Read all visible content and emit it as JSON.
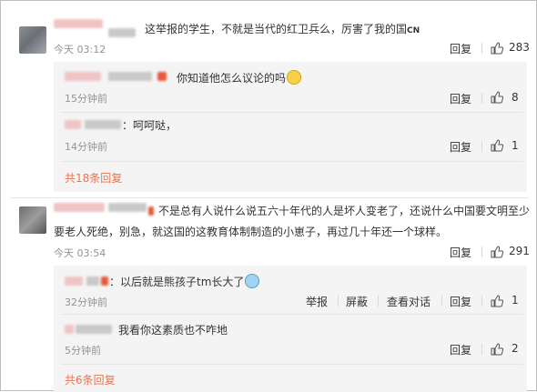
{
  "comments": [
    {
      "text": "这举报的学生，不就是当代的红卫兵么，厉害了我的国",
      "tag": "CN",
      "time": "今天 03:12",
      "reply_label": "回复",
      "likes": "283",
      "replies": [
        {
          "text": "你知道他怎么议论的吗",
          "emoji": "thinking-face",
          "time": "15分钟前",
          "reply_label": "回复",
          "likes": "8"
        },
        {
          "text": "：呵呵哒，",
          "time": "14分钟前",
          "reply_label": "回复",
          "likes": "1"
        }
      ],
      "more": "共18条回复"
    },
    {
      "text_line1": "不是总有人说什么说五六十年代的人是坏人变老了，还说什么中国要文明至少",
      "text_line2": "要老人死绝，别急，就这国的这教育体制制造的小崽子，再过几十年还一个球样。",
      "time": "今天 03:54",
      "reply_label": "回复",
      "likes": "291",
      "replies": [
        {
          "text": "：以后就是熊孩子tm长大了",
          "emoji": "fearful-face",
          "time": "32分钟前",
          "actions": [
            "举报",
            "屏蔽",
            "查看对话",
            "回复"
          ],
          "likes": "1"
        },
        {
          "text": "我看你这素质也不咋地",
          "time": "5分钟前",
          "reply_label": "回复",
          "likes": "2"
        }
      ],
      "more": "共6条回复"
    }
  ],
  "icons": {
    "like": "thumbs-up-icon"
  }
}
